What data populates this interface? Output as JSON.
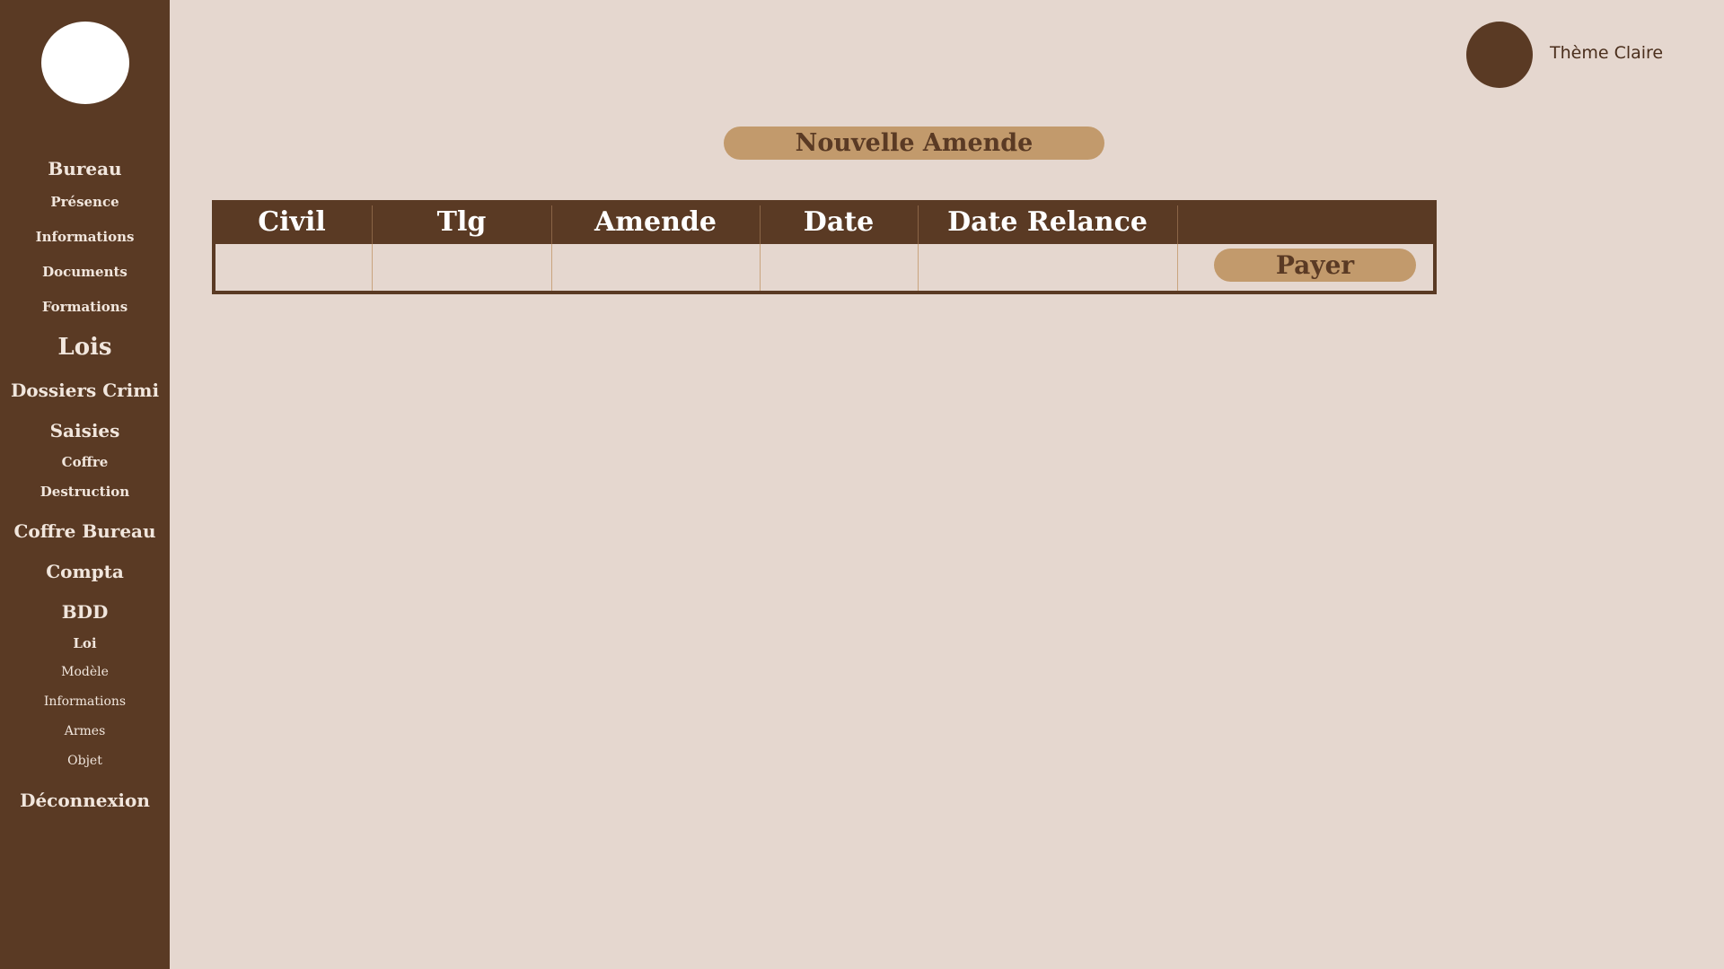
{
  "sidebar": {
    "items": [
      {
        "label": "Bureau"
      },
      {
        "label": "Présence"
      },
      {
        "label": "Informations"
      },
      {
        "label": "Documents"
      },
      {
        "label": "Formations"
      },
      {
        "label": "Lois"
      },
      {
        "label": "Dossiers Crimi"
      },
      {
        "label": "Saisies"
      },
      {
        "label": "Coffre"
      },
      {
        "label": "Destruction"
      },
      {
        "label": "Coffre Bureau"
      },
      {
        "label": "Compta"
      },
      {
        "label": "BDD"
      },
      {
        "label": "Loi"
      },
      {
        "label": "Modèle"
      },
      {
        "label": "Informations"
      },
      {
        "label": "Armes"
      },
      {
        "label": "Objet"
      },
      {
        "label": "Déconnexion"
      }
    ]
  },
  "header": {
    "theme_label": "Thème Claire"
  },
  "main": {
    "new_button_label": "Nouvelle Amende",
    "table": {
      "columns": [
        "Civil",
        "Tlg",
        "Amende",
        "Date",
        "Date Relance",
        ""
      ],
      "rows": [
        {
          "cells": [
            "",
            "",
            "",
            "",
            ""
          ],
          "action_label": "Payer"
        }
      ]
    }
  },
  "colors": {
    "sidebar_bg": "#5a3a24",
    "page_bg": "#e5d7cf",
    "accent": "#c29a6c",
    "text_dark": "#5a3a24"
  }
}
